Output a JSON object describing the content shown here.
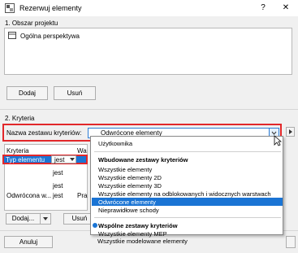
{
  "window": {
    "title": "Rezerwuj elementy",
    "help_glyph": "?",
    "close_glyph": "✕"
  },
  "section1": {
    "title": "1. Obszar projektu",
    "items": [
      {
        "label": "Ogólna perspektywa",
        "icon": "view-icon"
      }
    ],
    "add_label": "Dodaj",
    "remove_label": "Usuń"
  },
  "section2": {
    "title": "2. Kryteria",
    "set_label": "Nazwa zestawu kryteriów:",
    "set_value": "Odwrócone elementy",
    "table": {
      "header_criteria": "Kryteria",
      "header_value": "Wa",
      "rows": [
        {
          "criteria": "Typ elementu",
          "operator": "jest"
        },
        {
          "criteria": "",
          "operator": "jest"
        },
        {
          "criteria": "",
          "operator": "jest"
        },
        {
          "criteria": "Odwrócona w...",
          "operator": "jest",
          "value": "Pra"
        }
      ]
    },
    "add_label": "Dodaj...",
    "remove_label": "Usuń"
  },
  "dropdown": {
    "items_top": [
      "Użytkownika"
    ],
    "group_builtin": "Wbudowane zestawy kryteriów",
    "builtin_items": [
      "Wszystkie elementy",
      "Wszystkie elementy 2D",
      "Wszystkie elementy 3D",
      "Wszystkie elementy na odblokowanych i widocznych warstwach",
      "Odwrócone elementy",
      "Nieprawidłowe schody"
    ],
    "selected_index": 4,
    "group_shared": "Wspólne zestawy kryteriów",
    "shared_items": [
      "Wszystkie elementy MEP",
      "Wszystkie modelowane elementy"
    ]
  },
  "footer": {
    "cancel_label": "Anuluj"
  },
  "colors": {
    "accent": "#1a74d4",
    "highlight_border": "#e2272a"
  }
}
